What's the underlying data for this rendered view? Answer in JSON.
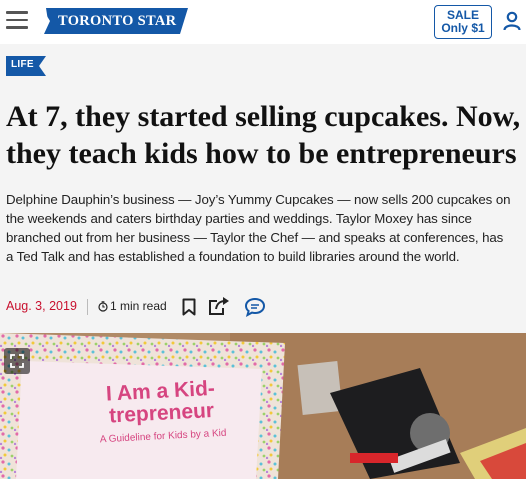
{
  "header": {
    "logo_text": "TORONTO STAR",
    "sale_line1": "SALE",
    "sale_line2": "Only $1",
    "menu_icon": "hamburger-icon",
    "account_icon": "user-icon"
  },
  "article": {
    "section": "LIFE",
    "headline": "At 7, they started selling cupcakes. Now, they teach kids how to be entrepreneurs",
    "dek": "Delphine Dauphin’s business — Joy’s Yummy Cupcakes — now sells 200 cupcakes on\nthe weekends and caters birthday parties and weddings. Taylor Moxey has since\nbranched out from her business — Taylor the Chef — and speaks at conferences, has\na Ted Talk and has established a foundation to build libraries around the world.",
    "date": "Aug. 3, 2019",
    "read_time": "1 min read"
  },
  "photo": {
    "book_title": "I Am a Kid-trepreneur",
    "book_subtitle": "A Guideline for Kids by a Kid"
  },
  "colors": {
    "brand_blue": "#1458a7",
    "date_red": "#c8102e",
    "book_pink": "#d64580"
  }
}
